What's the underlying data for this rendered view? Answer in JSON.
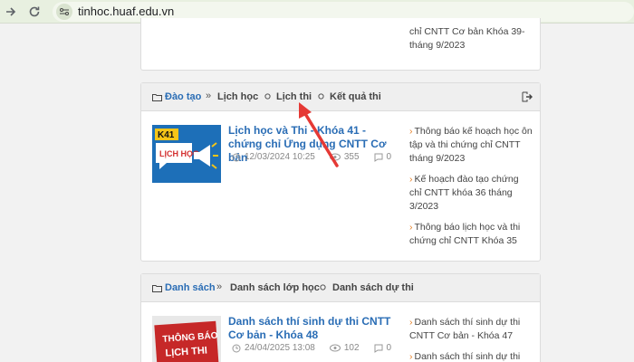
{
  "browser": {
    "url": "tinhoc.huaf.edu.vn"
  },
  "top_panel": {
    "side_items": [
      "chỉ CNTT Cơ bản Khóa 39-tháng 9/2023"
    ]
  },
  "dao_tao": {
    "category": "Đào tạo",
    "links": [
      "Lịch học",
      "Lịch thi",
      "Kết quả thi"
    ],
    "thumb_badge": "K41",
    "thumb_text": "LỊCH HỌC",
    "article_title": "Lịch học và Thi - Khóa 41 - chứng chỉ Ứng dụng CNTT Cơ bản",
    "date": "12/03/2024 10:25",
    "views": "355",
    "comments": "0",
    "side_items": [
      "Thông báo kế hoạch học ôn tập và thi chứng chỉ CNTT tháng 9/2023",
      "Kế hoạch đào tạo chứng chỉ CNTT khóa 36 tháng 3/2023",
      "Thông báo lịch học và thi chứng chỉ CNTT Khóa 35"
    ]
  },
  "danh_sach": {
    "category": "Danh sách",
    "links": [
      "Danh sách lớp học",
      "Danh sách dự thi"
    ],
    "thumb_line1": "THÔNG BÁO",
    "thumb_line2": "LỊCH THI",
    "article_title": "Danh sách thí sinh dự thi CNTT Cơ bản - Khóa 48",
    "date": "24/04/2025 13:08",
    "views": "102",
    "comments": "0",
    "side_items": [
      "Danh sách thí sinh dự thi CNTT Cơ bản - Khóa 47",
      "Danh sách thí sinh dự thi"
    ]
  },
  "colors": {
    "accent": "#2a6db5",
    "annotation_arrow": "#e53935"
  }
}
